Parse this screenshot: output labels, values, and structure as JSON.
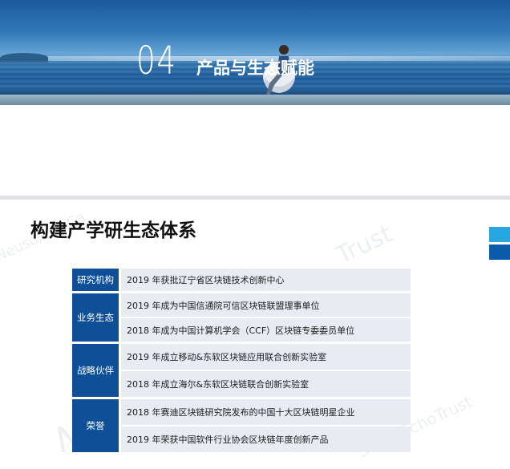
{
  "banner": {
    "section_number": "04",
    "section_title": "产品与生态赋能"
  },
  "slide": {
    "title": "构建产学研生态体系"
  },
  "watermarks": [
    "Neusoft SaCa",
    "Trust",
    "SaCa EchoTrust",
    "Ne"
  ],
  "colors": {
    "category_bg": "#0e4f97",
    "row_bg": "#e8ebf2",
    "tab_light": "#27a6e0",
    "tab_dark": "#0b5bab"
  },
  "table": {
    "groups": [
      {
        "category": "研究机构",
        "items": [
          "2019 年获批辽宁省区块链技术创新中心"
        ]
      },
      {
        "category": "业务生态",
        "items": [
          "2019 年成为中国信通院可信区块链联盟理事单位",
          "2018 年成为中国计算机学会（CCF）区块链专委委员单位"
        ]
      },
      {
        "category": "战略伙伴",
        "items": [
          "2019 年成立移动&东软区块链应用联合创新实验室",
          "2018 年成立海尔&东软区块链联合创新实验室"
        ]
      },
      {
        "category": "荣誉",
        "items": [
          "2018 年赛迪区块链研究院发布的中国十大区块链明星企业",
          "2019 年荣获中国软件行业协会区块链年度创新产品"
        ]
      }
    ]
  }
}
